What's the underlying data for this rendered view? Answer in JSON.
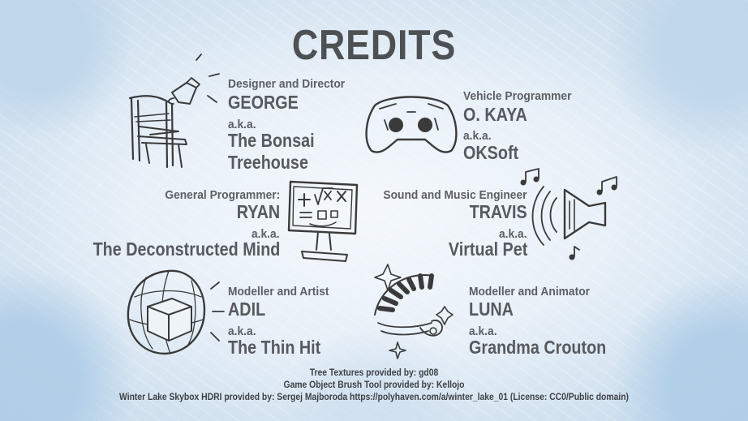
{
  "title": "CREDITS",
  "credits": [
    {
      "role": "Designer and Director",
      "name": "GEORGE",
      "aka": "a.k.a.",
      "alias_lines": [
        "The Bonsai",
        "Treehouse"
      ],
      "icon": "director-chair-megaphone-icon"
    },
    {
      "role": "Vehicle Programmer",
      "name": "O. KAYA",
      "aka": "a.k.a.",
      "alias_lines": [
        "OKSoft"
      ],
      "icon": "game-controller-icon"
    },
    {
      "role": "General Programmer:",
      "name": "RYAN",
      "aka": "a.k.a.",
      "alias_lines": [
        "The Deconstructed Mind"
      ],
      "icon": "computer-monitor-math-icon"
    },
    {
      "role": "Sound and Music Engineer",
      "name": "TRAVIS",
      "aka": "a.k.a.",
      "alias_lines": [
        "Virtual Pet"
      ],
      "icon": "speaker-music-notes-icon"
    },
    {
      "role": "Modeller and Artist",
      "name": "ADIL",
      "aka": "a.k.a.",
      "alias_lines": [
        "The Thin Hit"
      ],
      "icon": "3d-sphere-cube-icon"
    },
    {
      "role": "Modeller and Animator",
      "name": "LUNA",
      "aka": "a.k.a.",
      "alias_lines": [
        "Grandma Crouton"
      ],
      "icon": "sparkle-fan-skeleton-icon"
    }
  ],
  "footer": [
    "Tree Textures provided by:    gd08",
    "Game Object Brush Tool provided by:    Kellojo",
    "Winter Lake Skybox HDRI provided by: Sergej Majboroda https://polyhaven.com/a/winter_lake_01 (License: CC0/Public domain)"
  ],
  "colors": {
    "text": "#55585c",
    "sketch": "#3a3a3a",
    "ice": "#d3e3f0"
  }
}
